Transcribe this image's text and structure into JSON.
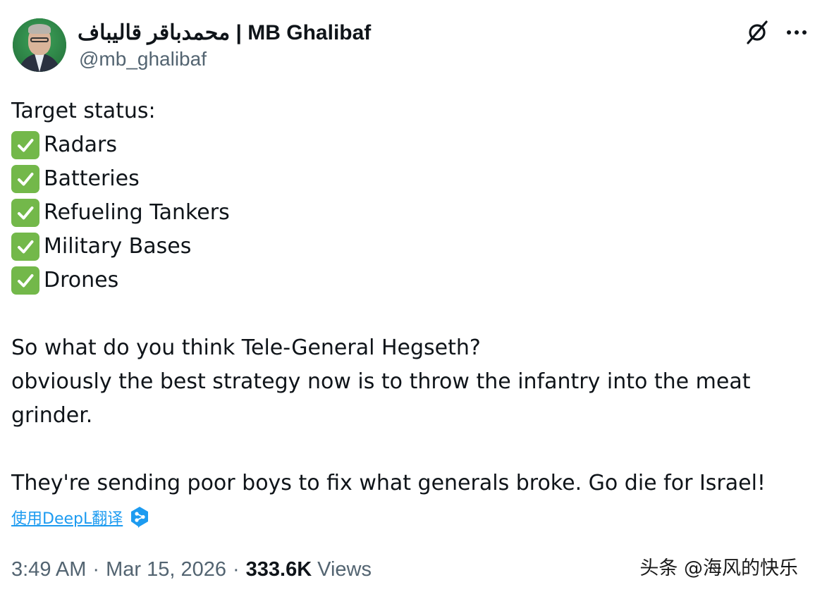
{
  "author": {
    "display_name": "محمدباقر قالیباف | MB Ghalibaf",
    "handle": "@mb_ghalibaf",
    "avatar_icon": "user-avatar-photo"
  },
  "header_actions": {
    "grok_icon": "grok-icon",
    "more_icon": "more-options-icon"
  },
  "tweet": {
    "intro": "Target status:",
    "checklist": [
      "Radars",
      "Batteries",
      "Refueling Tankers",
      "Military Bases",
      "Drones"
    ],
    "check_icon": "check-mark-button-emoji",
    "paragraph1_line1": "So what do you think Tele-General Hegseth?",
    "paragraph1_line2": "obviously the best strategy now is to throw the infantry into the meat grinder.",
    "paragraph2": "They're sending poor boys to fix what generals broke. Go die for Israel!"
  },
  "translate": {
    "label": "使用DeepL翻译",
    "icon": "deepl-icon"
  },
  "meta": {
    "time": "3:49 AM",
    "separator": "·",
    "date": "Mar 15, 2026",
    "views_count": "333.6K",
    "views_label": "Views"
  },
  "watermark": "头条 @海风的快乐",
  "colors": {
    "text": "#0f1419",
    "secondary": "#536471",
    "link": "#1d9bf0",
    "check_bg": "#73b84a"
  }
}
